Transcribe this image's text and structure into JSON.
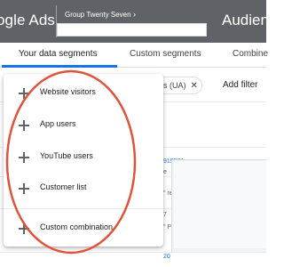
{
  "header": {
    "app_name": "ogle Ads",
    "account_name": "Group Twenty Seven",
    "account_chevron": "›",
    "page_title": "Audienc"
  },
  "tabs": [
    {
      "label": "Your data segments",
      "active": true
    },
    {
      "label": "Custom segments",
      "active": false
    },
    {
      "label": "Combine",
      "active": false
    }
  ],
  "filters": {
    "chip_label": "tics (UA)",
    "chip_close": "✕",
    "add_filter": "Add filter"
  },
  "table_fragments": [
    {
      "text": "919581",
      "kind": "link"
    },
    {
      "text": "e",
      "kind": "text"
    },
    {
      "text": "\" re",
      "kind": "text"
    },
    {
      "text": "7",
      "kind": "text"
    },
    {
      "text": "\" P",
      "kind": "text"
    },
    {
      "text": "20",
      "kind": "link"
    }
  ],
  "menu": {
    "items": [
      {
        "label": "Website visitors",
        "icon": "plus-icon"
      },
      {
        "label": "App users",
        "icon": "plus-icon"
      },
      {
        "label": "YouTube users",
        "icon": "plus-icon"
      },
      {
        "label": "Customer list",
        "icon": "plus-icon"
      },
      {
        "label": "Custom combination",
        "icon": "plus-icon"
      }
    ]
  },
  "colors": {
    "topbar": "#5f6368",
    "accent": "#1a73e8",
    "annotation": "#e0533a"
  }
}
